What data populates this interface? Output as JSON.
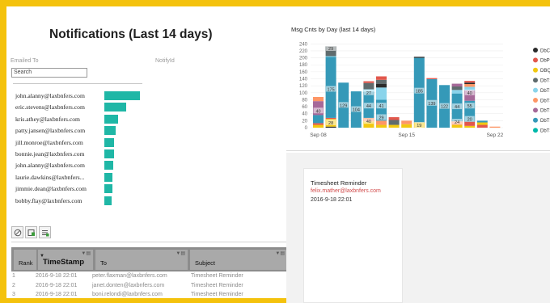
{
  "left": {
    "title": "Notifications (Last 14 days)",
    "emailed_to_label": "Emailed To",
    "notify_id_label": "NotifyId",
    "search_placeholder": "Search",
    "emails": [
      {
        "email": "john.alanny@laxbnfers.com",
        "share": 0.95
      },
      {
        "email": "eric.stevens@laxbnfers.com",
        "share": 0.58
      },
      {
        "email": "kris.athey@laxbnfers.com",
        "share": 0.38
      },
      {
        "email": "patty.jansen@laxbnfers.com",
        "share": 0.3
      },
      {
        "email": "jill.monroe@laxbnfers.com",
        "share": 0.26
      },
      {
        "email": "bonnie.jean@laxbnfers.com",
        "share": 0.25
      },
      {
        "email": "john.alanny@laxbnfers.com",
        "share": 0.24
      },
      {
        "email": "laurie.dawkins@laxbnfers...",
        "share": 0.22
      },
      {
        "email": "jimmie.dean@laxbnfers.com",
        "share": 0.21
      },
      {
        "email": "bobby.flay@laxbnfers.com",
        "share": 0.2
      }
    ]
  },
  "toolbar": {
    "icons": [
      "clear-icon",
      "filter-icon",
      "export-icon"
    ]
  },
  "table": {
    "headers": {
      "rank": "Rank",
      "timestamp": "TimeStamp",
      "to": "To",
      "subject": "Subject"
    },
    "rows": [
      {
        "rank": "1",
        "timestamp": "2016-9-18 22:01",
        "to": "peter.flaxman@laxbnfers.com",
        "subject": "Timesheet Reminder"
      },
      {
        "rank": "2",
        "timestamp": "2016-9-18 22:01",
        "to": "janet.donten@laxbnfers.com",
        "subject": "Timesheet Reminder"
      },
      {
        "rank": "3",
        "timestamp": "2016-9-18 22:01",
        "to": "boni.relondi@laxbnfers.com",
        "subject": "Timesheet Reminder"
      }
    ]
  },
  "chart_data": {
    "type": "bar",
    "title": "Msg Cnts by Day (last 14 days)",
    "ylim": [
      0,
      250
    ],
    "yticks": [
      0,
      20,
      40,
      60,
      80,
      100,
      120,
      140,
      160,
      180,
      200,
      220,
      240
    ],
    "xticks": [
      {
        "label": "Sep 08",
        "index": 0
      },
      {
        "label": "Sep 15",
        "index": 7
      },
      {
        "label": "Sep 22",
        "index": 14
      }
    ],
    "legend_position": "right",
    "legend": [
      {
        "name": "DbChe",
        "color": "#2b2b2b"
      },
      {
        "name": "DbProj",
        "color": "#e2574c"
      },
      {
        "name": "DBQVa",
        "color": "#f2c80f"
      },
      {
        "name": "DbTSA",
        "color": "#5f6b6d"
      },
      {
        "name": "DbTSA",
        "color": "#8ad4eb"
      },
      {
        "name": "DbTSA",
        "color": "#fe9666"
      },
      {
        "name": "DbTSC",
        "color": "#a66999"
      },
      {
        "name": "DbTSC",
        "color": "#3599b8"
      },
      {
        "name": "DbTSD",
        "color": "#01b8aa"
      }
    ],
    "days": [
      {
        "label": "Sep 08",
        "segments": [
          {
            "c": "#f2c80f",
            "v": 8
          },
          {
            "c": "#e2574c",
            "v": 5
          },
          {
            "c": "#3599b8",
            "v": 23
          },
          {
            "c": "#a66999",
            "v": 40
          },
          {
            "c": "#fe9666",
            "v": 12
          }
        ],
        "labels": [
          {
            "t": "40",
            "y": 48
          }
        ]
      },
      {
        "label": "",
        "segments": [
          {
            "c": "#2b2b2b",
            "v": 3
          },
          {
            "c": "#f2c80f",
            "v": 22
          },
          {
            "c": "#e2574c",
            "v": 3
          },
          {
            "c": "#3599b8",
            "v": 175
          },
          {
            "c": "#8ad4eb",
            "v": 2
          },
          {
            "c": "#5f6b6d",
            "v": 28
          }
        ],
        "labels": [
          {
            "t": "28",
            "y": 14
          },
          {
            "t": "175",
            "y": 110
          },
          {
            "t": "29",
            "y": 227
          }
        ]
      },
      {
        "label": "",
        "segments": [
          {
            "c": "#3599b8",
            "v": 129
          }
        ],
        "labels": [
          {
            "t": "129",
            "y": 64
          }
        ]
      },
      {
        "label": "",
        "segments": [
          {
            "c": "#3599b8",
            "v": 104
          }
        ],
        "labels": [
          {
            "t": "104",
            "y": 52
          }
        ]
      },
      {
        "label": "",
        "segments": [
          {
            "c": "#f2c80f",
            "v": 18
          },
          {
            "c": "#fe9666",
            "v": 10
          },
          {
            "c": "#3599b8",
            "v": 75
          },
          {
            "c": "#8ad4eb",
            "v": 7
          },
          {
            "c": "#5f6b6d",
            "v": 18
          },
          {
            "c": "#e2574c",
            "v": 5
          }
        ],
        "labels": [
          {
            "t": "40",
            "y": 18
          },
          {
            "t": "44",
            "y": 62
          },
          {
            "t": "27",
            "y": 100
          }
        ]
      },
      {
        "label": "",
        "segments": [
          {
            "c": "#f2c80f",
            "v": 8
          },
          {
            "c": "#fe9666",
            "v": 12
          },
          {
            "c": "#3599b8",
            "v": 60
          },
          {
            "c": "#8ad4eb",
            "v": 35
          },
          {
            "c": "#2b2b2b",
            "v": 10
          },
          {
            "c": "#5f6b6d",
            "v": 12
          },
          {
            "c": "#e2574c",
            "v": 10
          }
        ],
        "labels": [
          {
            "t": "29",
            "y": 29
          },
          {
            "t": "41",
            "y": 62
          }
        ]
      },
      {
        "label": "",
        "segments": [
          {
            "c": "#f2c80f",
            "v": 8
          },
          {
            "c": "#5f6b6d",
            "v": 14
          },
          {
            "c": "#e2574c",
            "v": 8
          }
        ],
        "labels": []
      },
      {
        "label": "Sep 15",
        "segments": [
          {
            "c": "#f2c80f",
            "v": 10
          },
          {
            "c": "#fe9666",
            "v": 10
          }
        ],
        "labels": []
      },
      {
        "label": "",
        "segments": [
          {
            "c": "#f2c80f",
            "v": 15
          },
          {
            "c": "#3599b8",
            "v": 185
          },
          {
            "c": "#2b2b2b",
            "v": 3
          }
        ],
        "labels": [
          {
            "t": "19",
            "y": 7
          },
          {
            "t": "185",
            "y": 105
          }
        ]
      },
      {
        "label": "",
        "segments": [
          {
            "c": "#3599b8",
            "v": 139
          },
          {
            "c": "#e2574c",
            "v": 3
          }
        ],
        "labels": [
          {
            "t": "139",
            "y": 70
          }
        ]
      },
      {
        "label": "",
        "segments": [
          {
            "c": "#3599b8",
            "v": 122
          }
        ],
        "labels": [
          {
            "t": "122",
            "y": 61
          }
        ]
      },
      {
        "label": "",
        "segments": [
          {
            "c": "#f2c80f",
            "v": 8
          },
          {
            "c": "#fe9666",
            "v": 10
          },
          {
            "c": "#3599b8",
            "v": 80
          },
          {
            "c": "#8ad4eb",
            "v": 10
          },
          {
            "c": "#5f6b6d",
            "v": 10
          },
          {
            "c": "#a66999",
            "v": 8
          }
        ],
        "labels": [
          {
            "t": "24",
            "y": 16
          },
          {
            "t": "44",
            "y": 60
          }
        ]
      },
      {
        "label": "",
        "segments": [
          {
            "c": "#f2c80f",
            "v": 5
          },
          {
            "c": "#e2574c",
            "v": 12
          },
          {
            "c": "#3599b8",
            "v": 60
          },
          {
            "c": "#a66999",
            "v": 30
          },
          {
            "c": "#8ad4eb",
            "v": 10
          },
          {
            "c": "#fe9666",
            "v": 8
          },
          {
            "c": "#2b2b2b",
            "v": 4
          },
          {
            "c": "#e2574c",
            "v": 5
          }
        ],
        "labels": [
          {
            "t": "20",
            "y": 24
          },
          {
            "t": "55",
            "y": 62
          },
          {
            "t": "40",
            "y": 100
          }
        ]
      },
      {
        "label": "",
        "segments": [
          {
            "c": "#e2574c",
            "v": 8
          },
          {
            "c": "#f2c80f",
            "v": 7
          },
          {
            "c": "#3599b8",
            "v": 5
          }
        ],
        "labels": []
      },
      {
        "label": "Sep 22",
        "segments": [
          {
            "c": "#fe9666",
            "v": 3
          }
        ],
        "labels": []
      }
    ]
  },
  "card": {
    "subject": "Timesheet Reminder",
    "email": "felix.mather@laxbnfers.com",
    "timestamp": "2016-9-18 22:01"
  }
}
